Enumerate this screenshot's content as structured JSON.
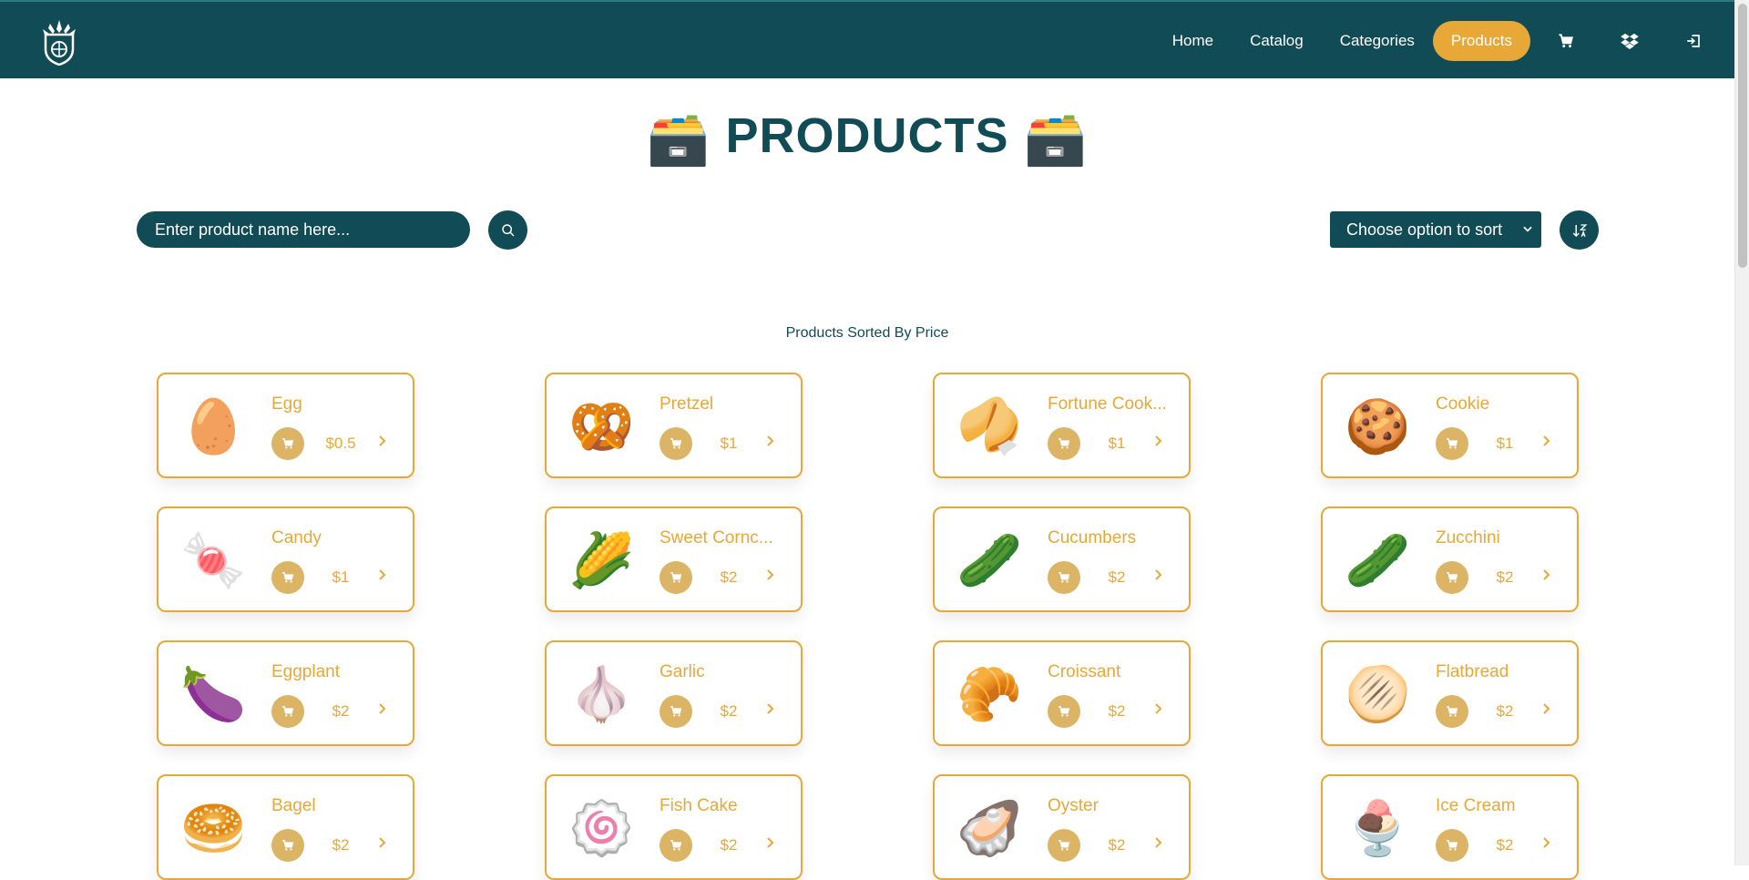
{
  "nav": {
    "links": [
      "Home",
      "Catalog",
      "Categories",
      "Products"
    ],
    "active_index": 3,
    "icons": [
      "cart-icon",
      "dropbox-icon",
      "logout-icon"
    ]
  },
  "page": {
    "title": "PRODUCTS",
    "title_emoji": "🗃️",
    "search_placeholder": "Enter product name here...",
    "sort_placeholder": "Choose option to sort",
    "subtitle": "Products Sorted By Price"
  },
  "colors": {
    "primary": "#114b55",
    "accent": "#e8a837",
    "cart_button": "#dcb466"
  },
  "products": [
    {
      "name": "Egg",
      "price": "$0.5",
      "emoji": "🥚"
    },
    {
      "name": "Pretzel",
      "price": "$1",
      "emoji": "🥨"
    },
    {
      "name": "Fortune Cook...",
      "price": "$1",
      "emoji": "🥠"
    },
    {
      "name": "Cookie",
      "price": "$1",
      "emoji": "🍪"
    },
    {
      "name": "Candy",
      "price": "$1",
      "emoji": "🍬"
    },
    {
      "name": "Sweet Cornc...",
      "price": "$2",
      "emoji": "🌽"
    },
    {
      "name": "Cucumbers",
      "price": "$2",
      "emoji": "🥒"
    },
    {
      "name": "Zucchini",
      "price": "$2",
      "emoji": "🥒"
    },
    {
      "name": "Eggplant",
      "price": "$2",
      "emoji": "🍆"
    },
    {
      "name": "Garlic",
      "price": "$2",
      "emoji": "🧄"
    },
    {
      "name": "Croissant",
      "price": "$2",
      "emoji": "🥐"
    },
    {
      "name": "Flatbread",
      "price": "$2",
      "emoji": "🫓"
    },
    {
      "name": "Bagel",
      "price": "$2",
      "emoji": "🥯"
    },
    {
      "name": "Fish Cake",
      "price": "$2",
      "emoji": "🍥"
    },
    {
      "name": "Oyster",
      "price": "$2",
      "emoji": "🦪"
    },
    {
      "name": "Ice Cream",
      "price": "$2",
      "emoji": "🍨"
    }
  ]
}
